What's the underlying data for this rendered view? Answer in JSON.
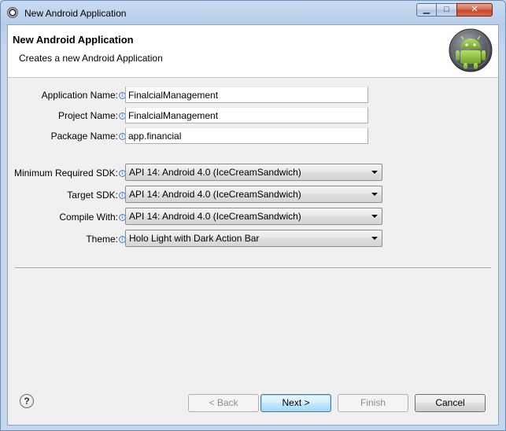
{
  "window": {
    "title": "New Android Application",
    "minimize_glyph": "▁",
    "maximize_glyph": "□",
    "close_glyph": "✕",
    "icon": "eclipse-icon"
  },
  "header": {
    "title": "New Android Application",
    "description": "Creates a new Android Application",
    "logo_icon": "android-logo-icon"
  },
  "form": {
    "application_name_label": "Application Name:",
    "application_name_value": "FinalcialManagement",
    "project_name_label": "Project Name:",
    "project_name_value": "FinalcialManagement",
    "package_name_label": "Package Name:",
    "package_name_value": "app.financial",
    "min_sdk_label": "Minimum Required SDK:",
    "min_sdk_value": "API 14: Android 4.0 (IceCreamSandwich)",
    "target_sdk_label": "Target SDK:",
    "target_sdk_value": "API 14: Android 4.0 (IceCreamSandwich)",
    "compile_with_label": "Compile With:",
    "compile_with_value": "API 14: Android 4.0 (IceCreamSandwich)",
    "theme_label": "Theme:",
    "theme_value": "Holo Light with Dark Action Bar",
    "info_glyph": "i"
  },
  "footer": {
    "help_glyph": "?",
    "back_label": "< Back",
    "next_label": "Next >",
    "finish_label": "Finish",
    "cancel_label": "Cancel"
  },
  "colors": {
    "android_green": "#8fc23e",
    "title_bar": "#c3d6ec",
    "default_button_border": "#3c7fb1"
  }
}
